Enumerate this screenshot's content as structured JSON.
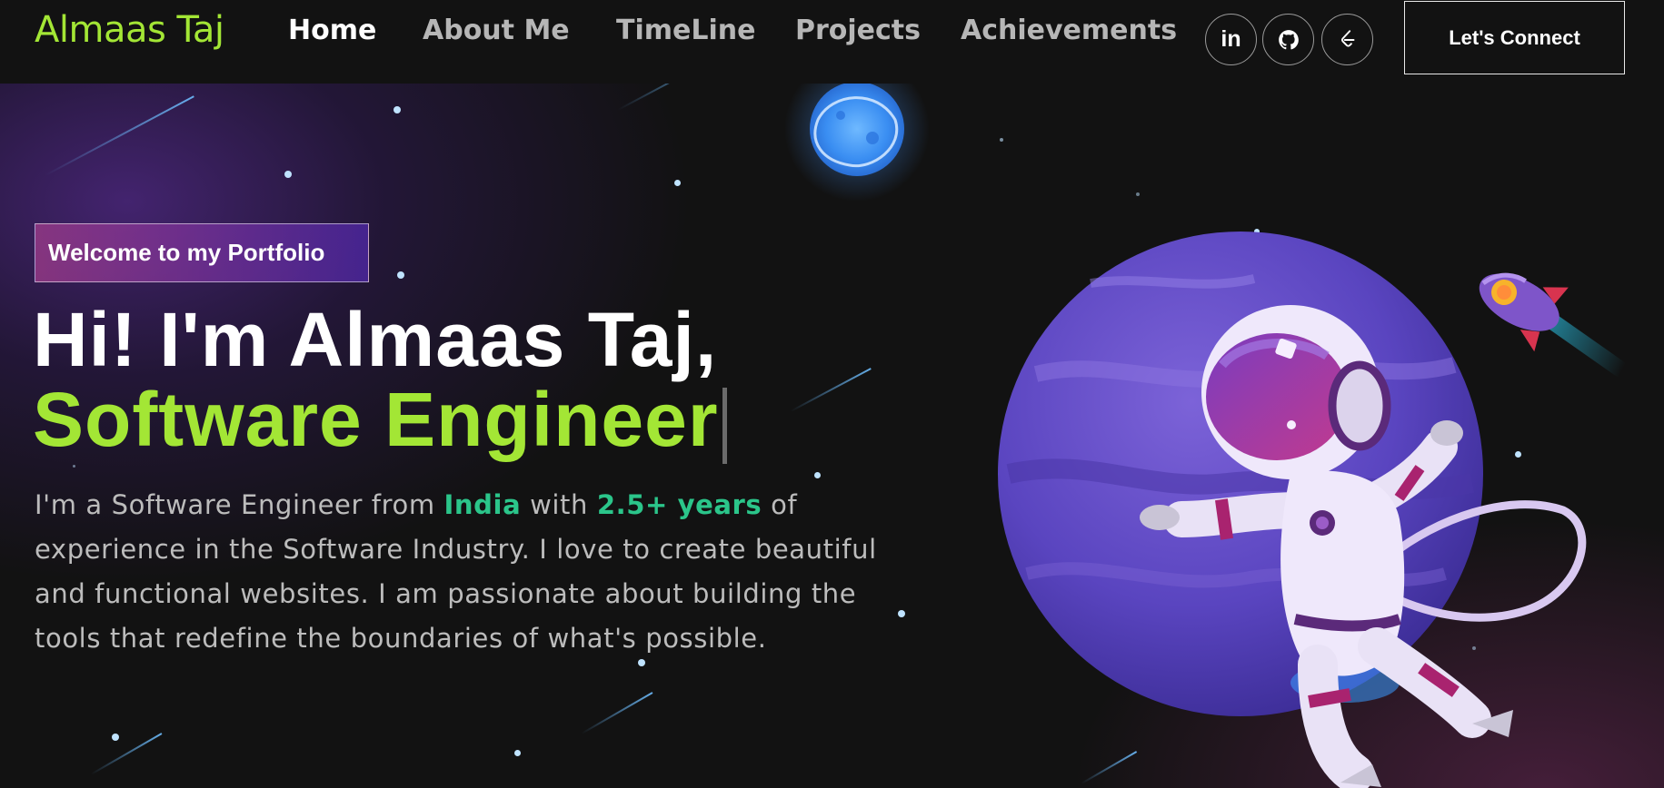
{
  "brand": {
    "name": "Almaas Taj",
    "accent": "#a3e635"
  },
  "nav": {
    "links": [
      {
        "label": "Home",
        "active": true
      },
      {
        "label": "About Me",
        "active": false
      },
      {
        "label": "TimeLine",
        "active": false
      },
      {
        "label": "Projects",
        "active": false
      },
      {
        "label": "Achievements",
        "active": false
      }
    ],
    "social": [
      {
        "icon": "linkedin-icon",
        "label": "in"
      },
      {
        "icon": "github-icon"
      },
      {
        "icon": "leetcode-icon"
      }
    ],
    "cta_label": "Let's Connect"
  },
  "hero": {
    "tagline": "Welcome to my Portfolio",
    "greeting": "Hi! I'm Almaas Taj,",
    "role": "Software Engineer",
    "intro": {
      "part1": "I'm a Software Engineer from ",
      "country": "India",
      "part2": " with ",
      "experience": "2.5+ years",
      "part3": " of experience in the Software Industry. I love to create beautiful and functional websites. I am passionate about building the tools that redefine the boundaries of what's possible."
    },
    "highlight_color": "#2bc58a",
    "illustration": [
      "planet-icon",
      "astronaut-icon",
      "rocket-icon",
      "moon-icon"
    ]
  }
}
